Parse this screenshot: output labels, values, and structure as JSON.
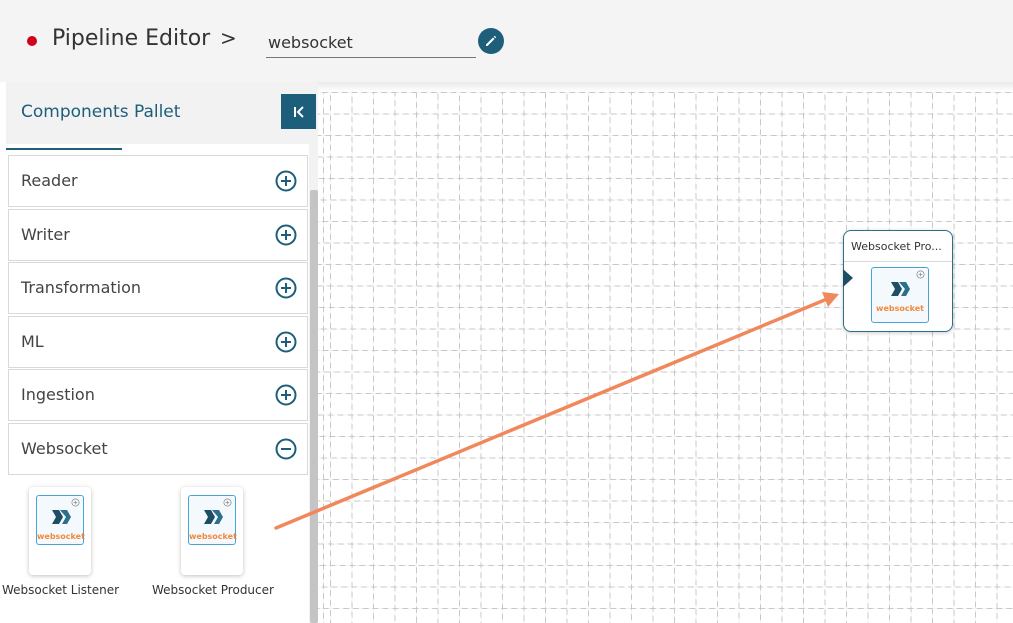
{
  "header": {
    "title": "Pipeline Editor",
    "separator": ">",
    "pipeline_name": "websocket"
  },
  "sidebar": {
    "title": "Components Pallet",
    "categories": [
      {
        "label": "Reader",
        "expanded": false
      },
      {
        "label": "Writer",
        "expanded": false
      },
      {
        "label": "Transformation",
        "expanded": false
      },
      {
        "label": "ML",
        "expanded": false
      },
      {
        "label": "Ingestion",
        "expanded": false
      },
      {
        "label": "Websocket",
        "expanded": true
      }
    ],
    "components": [
      {
        "label": "Websocket Listener",
        "logo_text": "websocket"
      },
      {
        "label": "Websocket Producer",
        "logo_text": "websocket"
      }
    ]
  },
  "canvas": {
    "node": {
      "title": "Websocket Pro...",
      "logo_text": "websocket"
    }
  },
  "colors": {
    "accent": "#1d5f7a",
    "status_dot": "#d0021b",
    "arrow": "#f0885c",
    "logo_orange": "#f08a3c",
    "tile_border": "#4aa3d6"
  },
  "icons": {
    "status": "red-dot",
    "edit": "pencil-icon",
    "collapse": "collapse-left-icon",
    "expand": "plus-circle-icon",
    "collapse_category": "minus-circle-icon",
    "component_logo": "websocket-logo"
  }
}
